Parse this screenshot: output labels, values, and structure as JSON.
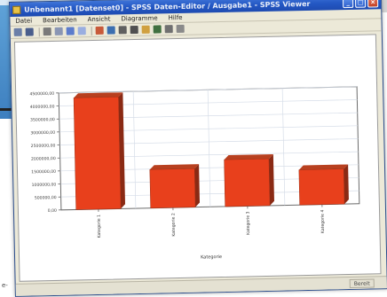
{
  "window": {
    "title": "Unbenannt1 [Datenset0] - SPSS Daten-Editor / Ausgabe1 - SPSS Viewer"
  },
  "menu": [
    "Datei",
    "Bearbeiten",
    "Ansicht",
    "Diagramme",
    "Hilfe"
  ],
  "toolbar_icons": [
    "open-icon",
    "save-icon",
    "print-icon",
    "preview-icon",
    "undo-icon",
    "redo-icon",
    "chart-icon",
    "zoom-icon",
    "find-icon",
    "insert-icon",
    "format-icon",
    "hide-icon",
    "edit-icon",
    "select-icon"
  ],
  "chart_data": {
    "type": "bar",
    "categories": [
      "Kategorie 1",
      "Kategorie 2",
      "Kategorie 3",
      "Kategorie 4"
    ],
    "values": [
      4300000,
      1480000,
      1800000,
      1350000
    ],
    "ylim": [
      0,
      4500000
    ],
    "ytick_step": 500000,
    "yticks": [
      "0,00",
      "500000,00",
      "1000000,00",
      "1500000,00",
      "2000000,00",
      "2500000,00",
      "3000000,00",
      "3500000,00",
      "4000000,00",
      "4500000,00"
    ],
    "xlabel": "Kategorie",
    "ylabel": "",
    "bar_color": "#e8401c",
    "bar_shadow_color": "#8a2a14",
    "grid": true
  },
  "status": {
    "right": "Bereit"
  },
  "crop_fragment": "e-"
}
